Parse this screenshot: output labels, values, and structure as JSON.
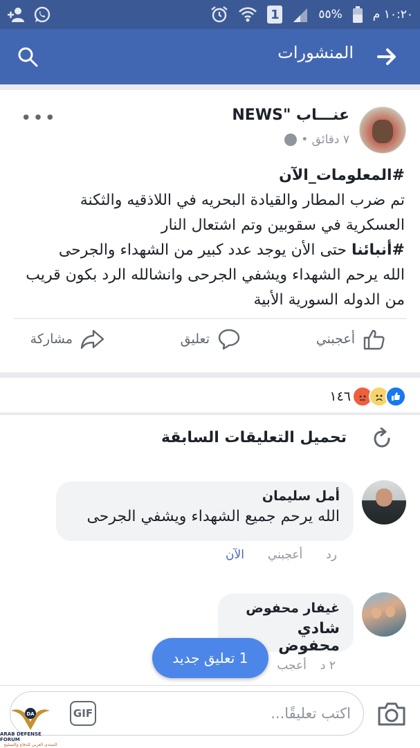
{
  "status_bar": {
    "time": "١٠:٢٠ م",
    "battery": "%٥٥",
    "sim": "1"
  },
  "app_bar": {
    "title": "المنشورات"
  },
  "post": {
    "page_name": "عنـــاب \"NEWS",
    "time": "٧ دقائق •",
    "line1_hash": "#المعلومات_الآن",
    "line2": "تم ضرب المطار والقيادة البحريه في اللاذقيه والثكنة",
    "line3": "العسكرية في سقوبين وتم اشتعال النار",
    "line4_hash": "#أنبائنا",
    "line4_rest": " حتى الأن يوجد عدد كبير من الشهداء والجرحى",
    "line5": "الله يرحم الشهداء ويشفي الجرحى وانشالله الرد بكون قريب",
    "line6": "من الدوله السورية الأبية",
    "actions": {
      "like": "أعجبني",
      "comment": "تعليق",
      "share": "مشاركة"
    }
  },
  "reactions": {
    "count": "١٤٦"
  },
  "comments": {
    "load_previous": "تحميل التعليقات السابقة",
    "items": [
      {
        "name": "أمل سليمان",
        "text": "الله يرحم جميع الشهداء ويشفي الجرحى",
        "reply": "رد",
        "like": "أعجبني",
        "time": "الآن"
      },
      {
        "name": "غيفار محفوض",
        "text": "شادي محفوض",
        "time": "٢ د",
        "like": "أعجب",
        "reply": ""
      }
    ],
    "new_comment_pill": "1 تعليق جديد"
  },
  "composer": {
    "placeholder": "اكتب تعليقًا...",
    "gif": "GIF"
  },
  "watermark": {
    "text": "ARAB DEFENSE FORUM",
    "sub": "المنتدى العربي للدفاع والتسليح",
    "logo": "DA"
  },
  "colors": {
    "status_bar": "#3b5a95",
    "app_bar": "#4267b2",
    "accent": "#4267b2",
    "new_pill": "#4c86e8"
  }
}
